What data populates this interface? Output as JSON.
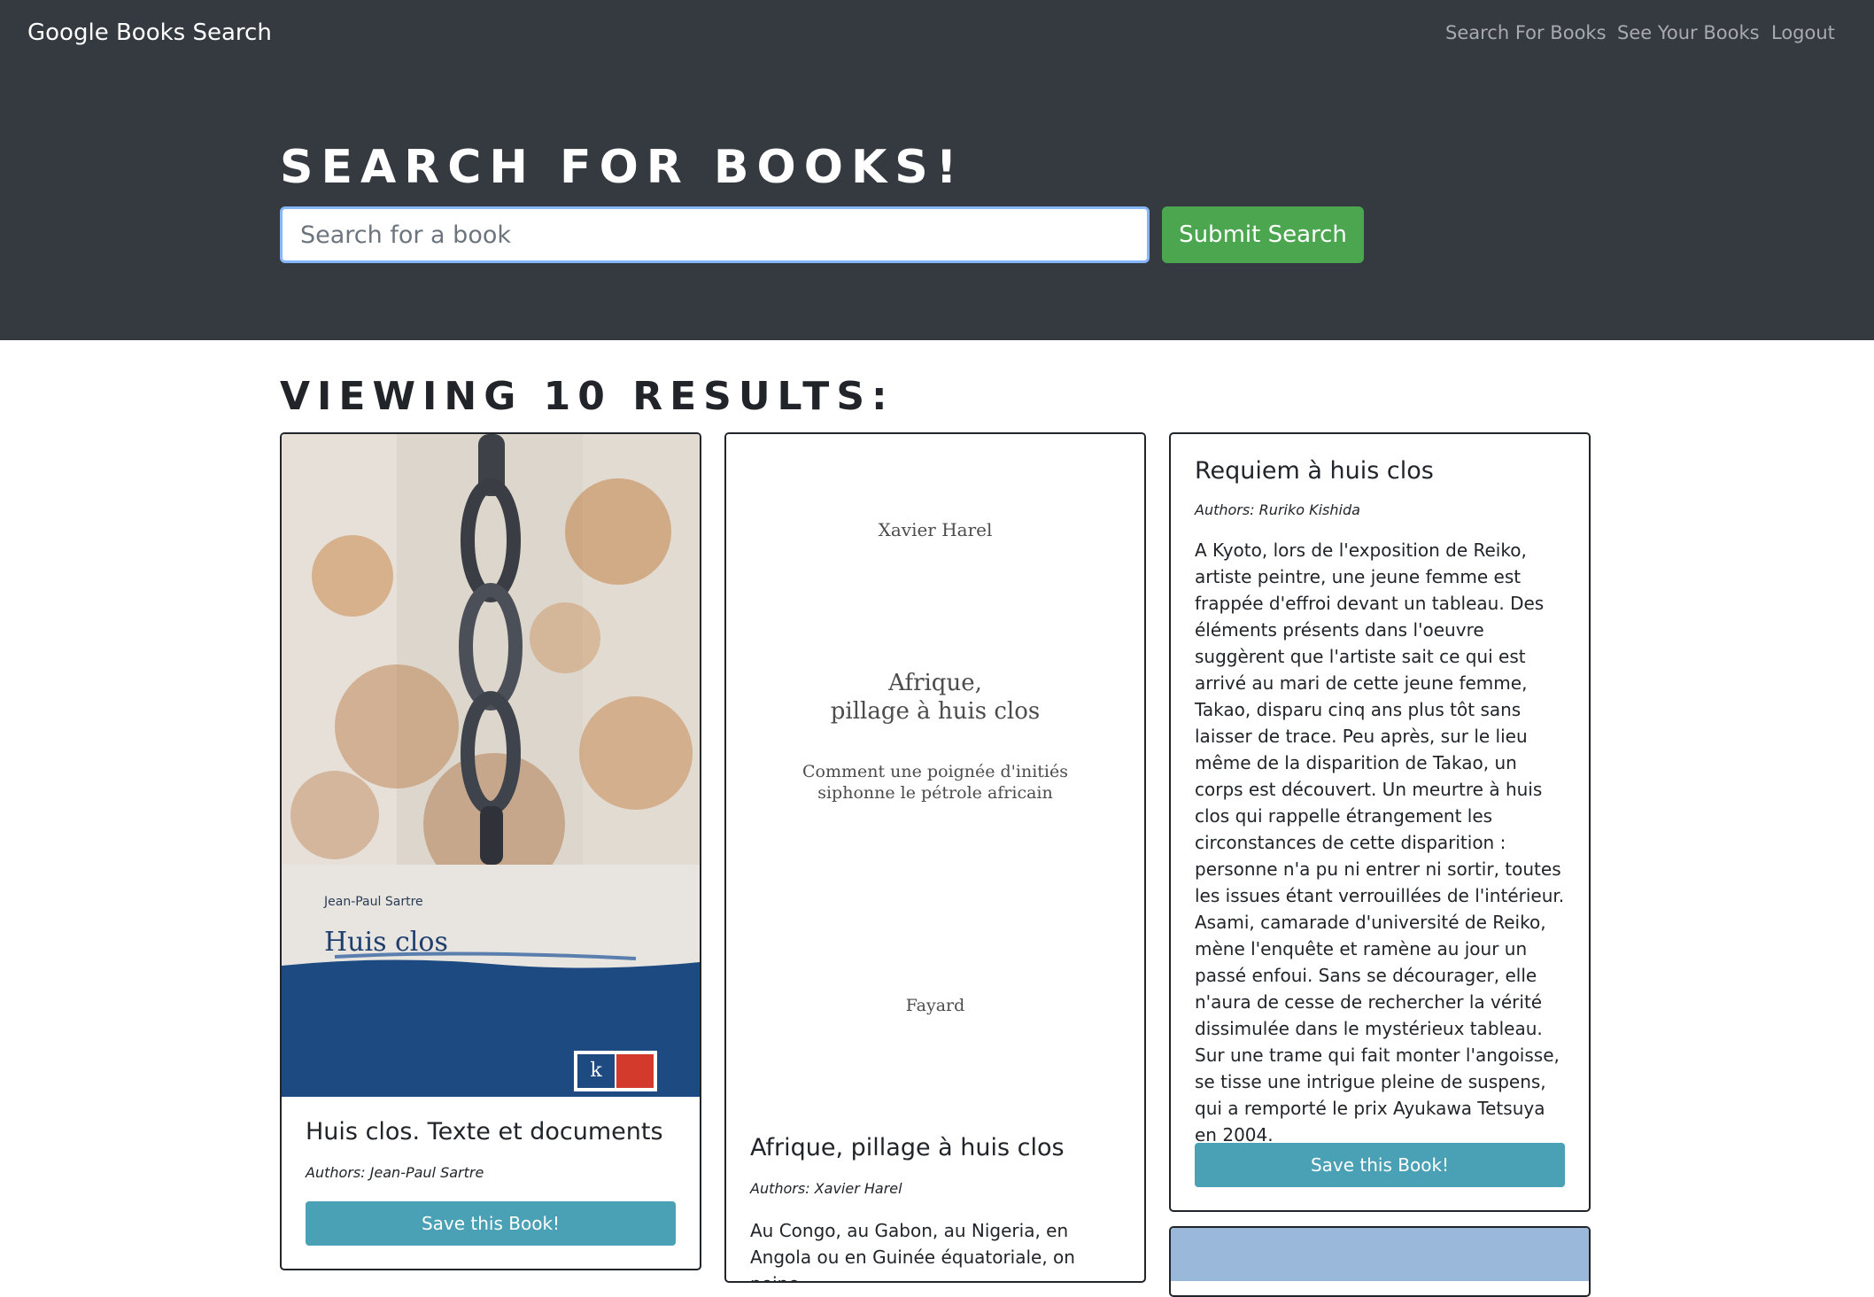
{
  "nav": {
    "brand": "Google Books Search",
    "links": [
      "Search For Books",
      "See Your Books",
      "Logout"
    ]
  },
  "hero": {
    "title": "Search for Books!",
    "search_placeholder": "Search for a book",
    "search_value": "",
    "submit_label": "Submit Search"
  },
  "results": {
    "title": "Viewing 10 results:",
    "save_label": "Save this Book!",
    "cards": [
      {
        "title": "Huis clos. Texte et documents",
        "authors": "Authors: Jean-Paul Sartre",
        "cover": {
          "small": "Jean-Paul Sartre",
          "title": "Huis clos"
        }
      },
      {
        "title": "Afrique, pillage à huis clos",
        "authors": "Authors: Xavier Harel",
        "description": "Au Congo, au Gabon, au Nigeria, en Angola ou en Guinée équatoriale, on peine",
        "cover": {
          "author": "Xavier Harel",
          "title_line1": "Afrique,",
          "title_line2": "pillage à huis clos",
          "subtitle_line1": "Comment une poignée d'initiés",
          "subtitle_line2": "siphonne le pétrole africain",
          "publisher": "Fayard"
        }
      },
      {
        "title": "Requiem à huis clos",
        "authors": "Authors: Ruriko Kishida",
        "description": "A Kyoto, lors de l'exposition de Reiko, artiste peintre, une jeune femme est frappée d'effroi devant un tableau. Des éléments présents dans l'oeuvre suggèrent que l'artiste sait ce qui est arrivé au mari de cette jeune femme, Takao, disparu cinq ans plus tôt sans laisser de trace. Peu après, sur le lieu même de la disparition de Takao, un corps est découvert. Un meurtre à huis clos qui rappelle étrangement les circonstances de cette disparition : personne n'a pu ni entrer ni sortir, toutes les issues étant verrouillées de l'intérieur. Asami, camarade d'université de Reiko, mène l'enquête et ramène au jour un passé enfoui. Sans se décourager, elle n'aura de cesse de rechercher la vérité dissimulée dans le mystérieux tableau. Sur une trame qui fait monter l'angoisse, se tisse une intrigue pleine de suspens, qui a remporté le prix Ayukawa Tetsuya en 2004."
      }
    ]
  }
}
